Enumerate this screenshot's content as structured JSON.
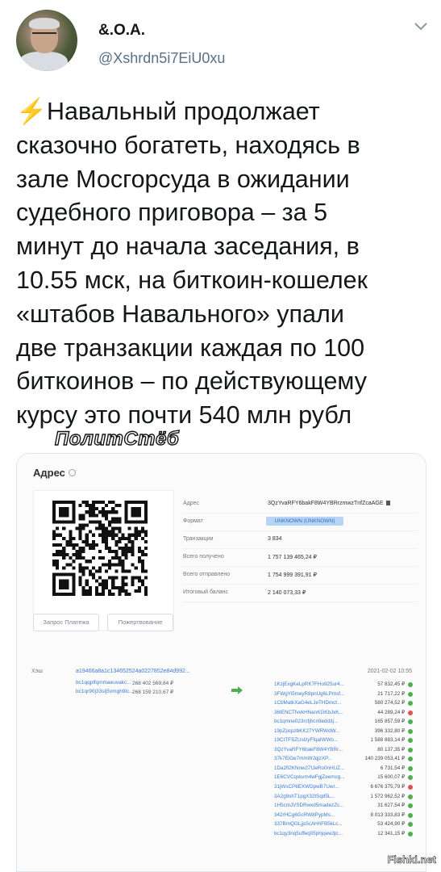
{
  "header": {
    "display_name": "&.O.A.",
    "handle": "@Xshrdn5i7EiU0xu"
  },
  "tweet": {
    "bolt": "⚡",
    "text": "Навальный продолжает\nсказочно богатеть, находясь в\nзале Мосгорсуда в ожидании\nсудебного приговора – за 5\nминут до начала заседания, в\n10.55 мск, на биткоин-кошелек\n«штабов Навального» упали\nдве транзакции каждая по 100\nбиткоинов – по действующему\nкурсу это почти 540 млн рубл"
  },
  "watermark": "ПолитСтёб",
  "card": {
    "title": "Адрес",
    "buttons": [
      "Запрос Платежа",
      "Пожертвование"
    ],
    "rows": [
      {
        "label": "Адрес",
        "value": "3QzYvaRFY6bakF8W4YBRrzmwzTnfZcaAGE"
      },
      {
        "label": "Формат",
        "value": "UNKNOWN (UNKNOWN)"
      },
      {
        "label": "Транзакции",
        "value": "3 834"
      },
      {
        "label": "Всего получено",
        "value": "1 757 139 465,24 ₽"
      },
      {
        "label": "Всего отправлено",
        "value": "1 754 999 391,91 ₽"
      },
      {
        "label": "Итоговый баланс",
        "value": "2 140 073,33 ₽"
      }
    ],
    "tx": {
      "label": "Хэш",
      "hash": "a19466a8a1c134652524a0227852e84d992...",
      "date": "2021-02-02 10:55",
      "inputs": [
        {
          "addr": "bc1qqplfqmmaeuvakc...",
          "amount": "268 402 569,84 ₽"
        },
        {
          "addr": "bc1qr90j33slj5vmgh9lc...",
          "amount": "268 159 210,67 ₽"
        }
      ],
      "outputs": [
        {
          "addr": "1KzjExgKeLpRK7FHo925ur4...",
          "amount": "57 832,45 ₽",
          "status": "green"
        },
        {
          "addr": "3FWgYi5meyR8pnUg6LPmsf...",
          "amount": "21 717,22 ₽",
          "status": "green"
        },
        {
          "addr": "1CbMatkXaG4eLJeTHDmct...",
          "amount": "580 274,52 ₽",
          "status": "green"
        },
        {
          "addr": "36tENCTfvvkHNanKGKbJxK...",
          "amount": "44 289,24 ₽",
          "status": "red"
        },
        {
          "addr": "bc1qmne023rcfjhcn9edd3j...",
          "amount": "165 857,59 ₽",
          "status": "green"
        },
        {
          "addr": "19pZpcpzbKK27YWRWdW...",
          "amount": "396 332,80 ₽",
          "status": "green"
        },
        {
          "addr": "19CtTFSZUslzyFfqatWWo...",
          "amount": "1 588 883,14 ₽",
          "status": "green"
        },
        {
          "addr": "3QzYvaRFY6bakF8W4YBRr...",
          "amount": "80 137,35 ₽",
          "status": "green"
        },
        {
          "addr": "37k7EiGe7mmWJqjzXP...",
          "amount": "140 239 053,41 ₽",
          "status": "green"
        },
        {
          "addr": "1Da2fi2KNnw27tJeRo0nHUZ...",
          "amount": "6 731,54 ₽",
          "status": "green"
        },
        {
          "addr": "1E6CVCqskvm4wFgjZeemcg...",
          "amount": "15 600,07 ₽",
          "status": "green"
        },
        {
          "addr": "31jWsCP6EXWDpwB7Uwr...",
          "amount": "6 676 375,79 ₽",
          "status": "red"
        },
        {
          "addr": "3A2g9shT1pgX32tSqd5L...",
          "amount": "1 572 962,52 ₽",
          "status": "green"
        },
        {
          "addr": "1H5cmJVSDRwxd5madezZc...",
          "amount": "31 627,54 ₽",
          "status": "green"
        },
        {
          "addr": "342rHCg6GcRW8PypMs...",
          "amount": "8 013 333,83 ₽",
          "status": "green"
        },
        {
          "addr": "337BmQGLjjs5cAHhFB5kLc...",
          "amount": "53 424,90 ₽",
          "status": "green"
        },
        {
          "addr": "bc1qy3nq5uffeq05phjqew3jc...",
          "amount": "12 341,15 ₽",
          "status": "green"
        }
      ]
    }
  },
  "fishki": "Fishki.net",
  "colors": {
    "accent": "#3a7bd5",
    "bolt": "#f5b800",
    "positive": "#4caf50",
    "negative": "#e05252"
  }
}
